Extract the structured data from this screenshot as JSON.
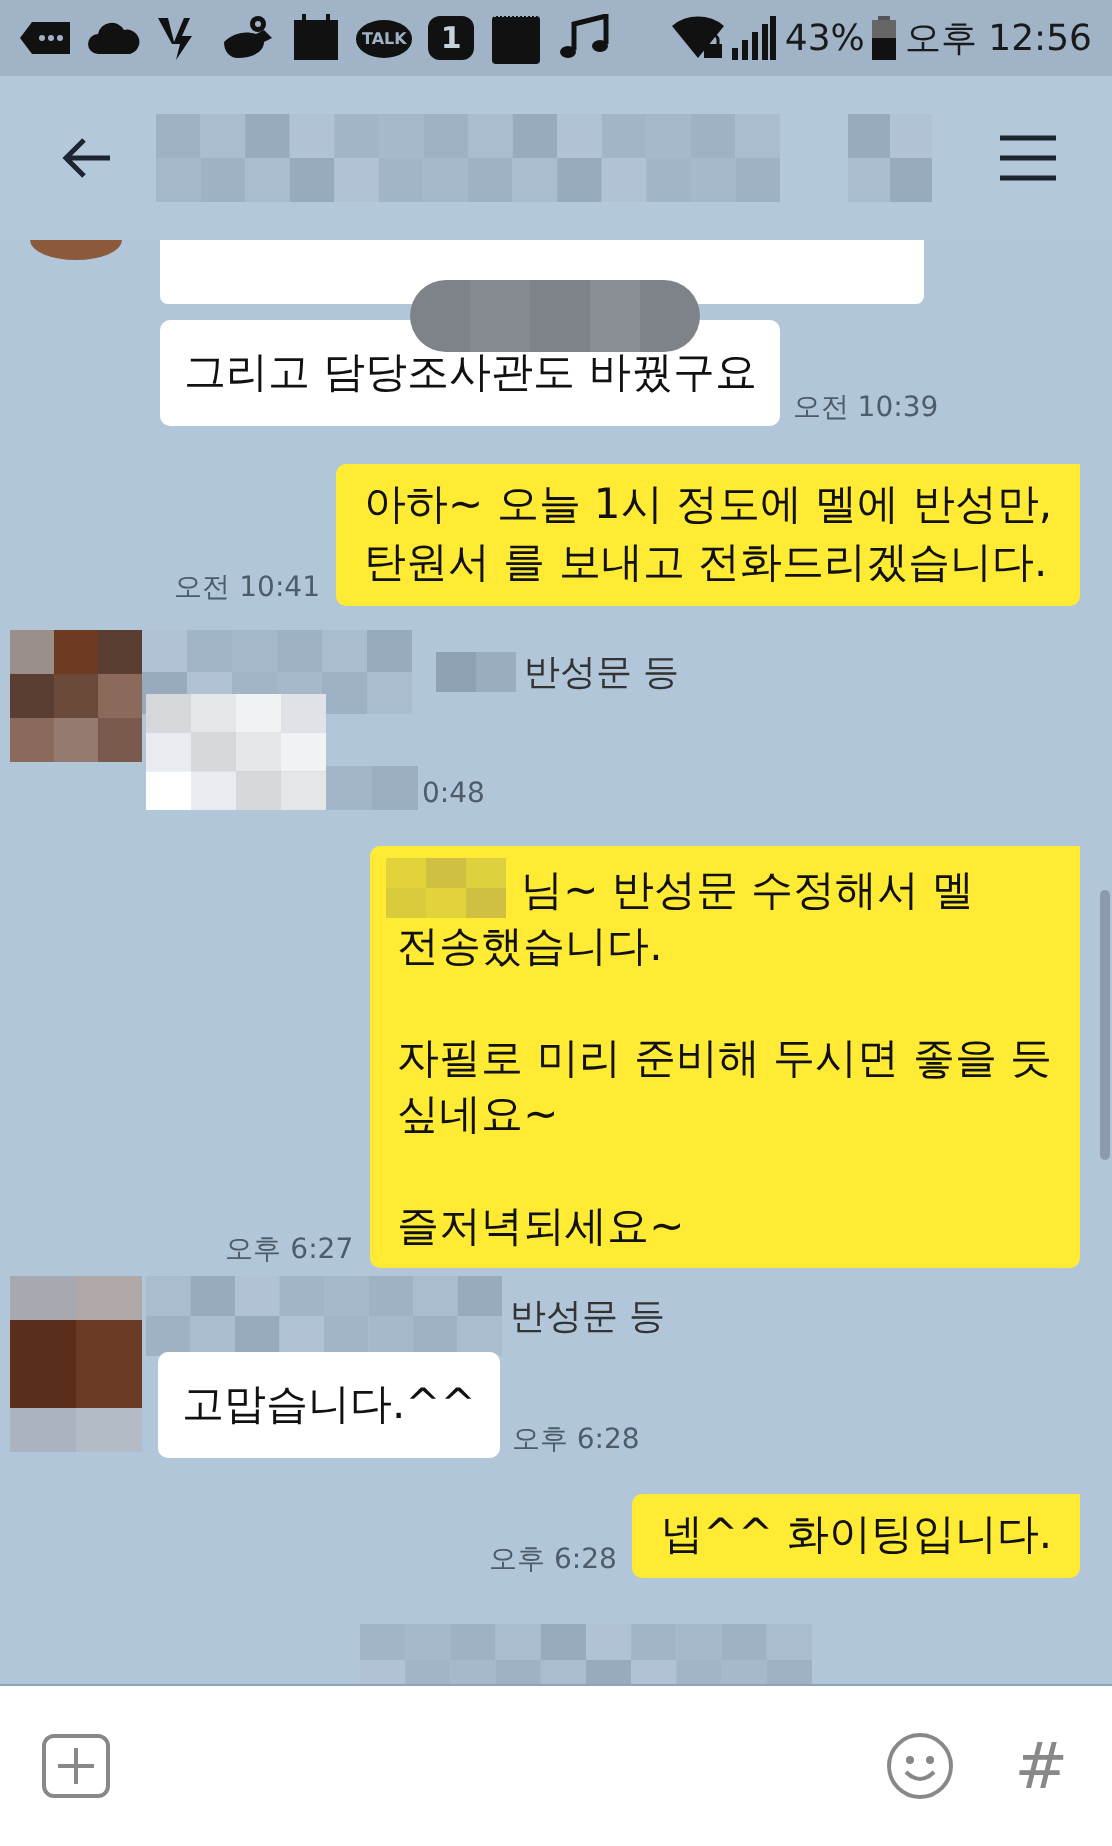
{
  "status_bar": {
    "notifications": [
      {
        "kind": "more"
      },
      {
        "kind": "cloud"
      },
      {
        "kind": "bolt"
      },
      {
        "kind": "bird"
      },
      {
        "kind": "calendar"
      },
      {
        "kind": "talk",
        "label": "TALK"
      },
      {
        "kind": "badge",
        "label": "1"
      },
      {
        "kind": "note"
      },
      {
        "kind": "music"
      }
    ],
    "battery_percent": "43%",
    "time": "오후 12:56"
  },
  "messages": [
    {
      "kind": "received_cut"
    },
    {
      "kind": "received",
      "text": "그리고 담당조사관도 바꿨구요",
      "time": "오전 10:39"
    },
    {
      "kind": "sent",
      "text": "아하~ 오늘 1시 정도에 멜에 반성만,\n탄원서 를 보내고 전화드리겠습니다.",
      "time": "오전 10:41"
    },
    {
      "kind": "received_image",
      "sender_suffix": "반성문 등",
      "time": "0:48"
    },
    {
      "kind": "sent_redacted",
      "text": "님~ 반성문 수정해서 멜\n전송했습니다.\n\n자필로 미리 준비해 두시면 좋을 듯\n싶네요~\n\n즐저녁되세요~",
      "time": "오후 6:27"
    },
    {
      "kind": "received_profile",
      "sender_suffix": "반성문 등",
      "text": "고맙습니다.^^",
      "time": "오후 6:28"
    },
    {
      "kind": "sent",
      "text": "넵^^ 화이팅입니다.",
      "time": "오후 6:28"
    }
  ],
  "input_bar": {
    "hash_button": "#"
  }
}
